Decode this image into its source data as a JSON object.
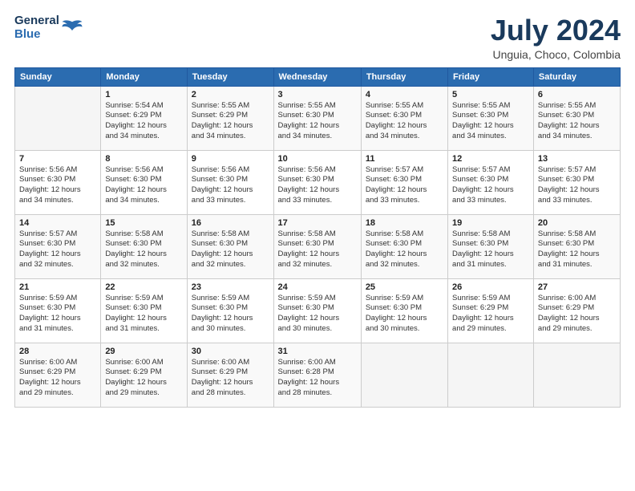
{
  "header": {
    "logo_line1": "General",
    "logo_line2": "Blue",
    "month": "July 2024",
    "location": "Unguia, Choco, Colombia"
  },
  "weekdays": [
    "Sunday",
    "Monday",
    "Tuesday",
    "Wednesday",
    "Thursday",
    "Friday",
    "Saturday"
  ],
  "weeks": [
    [
      {
        "day": "",
        "info": ""
      },
      {
        "day": "1",
        "info": "Sunrise: 5:54 AM\nSunset: 6:29 PM\nDaylight: 12 hours\nand 34 minutes."
      },
      {
        "day": "2",
        "info": "Sunrise: 5:55 AM\nSunset: 6:29 PM\nDaylight: 12 hours\nand 34 minutes."
      },
      {
        "day": "3",
        "info": "Sunrise: 5:55 AM\nSunset: 6:30 PM\nDaylight: 12 hours\nand 34 minutes."
      },
      {
        "day": "4",
        "info": "Sunrise: 5:55 AM\nSunset: 6:30 PM\nDaylight: 12 hours\nand 34 minutes."
      },
      {
        "day": "5",
        "info": "Sunrise: 5:55 AM\nSunset: 6:30 PM\nDaylight: 12 hours\nand 34 minutes."
      },
      {
        "day": "6",
        "info": "Sunrise: 5:55 AM\nSunset: 6:30 PM\nDaylight: 12 hours\nand 34 minutes."
      }
    ],
    [
      {
        "day": "7",
        "info": "Sunrise: 5:56 AM\nSunset: 6:30 PM\nDaylight: 12 hours\nand 34 minutes."
      },
      {
        "day": "8",
        "info": "Sunrise: 5:56 AM\nSunset: 6:30 PM\nDaylight: 12 hours\nand 34 minutes."
      },
      {
        "day": "9",
        "info": "Sunrise: 5:56 AM\nSunset: 6:30 PM\nDaylight: 12 hours\nand 33 minutes."
      },
      {
        "day": "10",
        "info": "Sunrise: 5:56 AM\nSunset: 6:30 PM\nDaylight: 12 hours\nand 33 minutes."
      },
      {
        "day": "11",
        "info": "Sunrise: 5:57 AM\nSunset: 6:30 PM\nDaylight: 12 hours\nand 33 minutes."
      },
      {
        "day": "12",
        "info": "Sunrise: 5:57 AM\nSunset: 6:30 PM\nDaylight: 12 hours\nand 33 minutes."
      },
      {
        "day": "13",
        "info": "Sunrise: 5:57 AM\nSunset: 6:30 PM\nDaylight: 12 hours\nand 33 minutes."
      }
    ],
    [
      {
        "day": "14",
        "info": "Sunrise: 5:57 AM\nSunset: 6:30 PM\nDaylight: 12 hours\nand 32 minutes."
      },
      {
        "day": "15",
        "info": "Sunrise: 5:58 AM\nSunset: 6:30 PM\nDaylight: 12 hours\nand 32 minutes."
      },
      {
        "day": "16",
        "info": "Sunrise: 5:58 AM\nSunset: 6:30 PM\nDaylight: 12 hours\nand 32 minutes."
      },
      {
        "day": "17",
        "info": "Sunrise: 5:58 AM\nSunset: 6:30 PM\nDaylight: 12 hours\nand 32 minutes."
      },
      {
        "day": "18",
        "info": "Sunrise: 5:58 AM\nSunset: 6:30 PM\nDaylight: 12 hours\nand 32 minutes."
      },
      {
        "day": "19",
        "info": "Sunrise: 5:58 AM\nSunset: 6:30 PM\nDaylight: 12 hours\nand 31 minutes."
      },
      {
        "day": "20",
        "info": "Sunrise: 5:58 AM\nSunset: 6:30 PM\nDaylight: 12 hours\nand 31 minutes."
      }
    ],
    [
      {
        "day": "21",
        "info": "Sunrise: 5:59 AM\nSunset: 6:30 PM\nDaylight: 12 hours\nand 31 minutes."
      },
      {
        "day": "22",
        "info": "Sunrise: 5:59 AM\nSunset: 6:30 PM\nDaylight: 12 hours\nand 31 minutes."
      },
      {
        "day": "23",
        "info": "Sunrise: 5:59 AM\nSunset: 6:30 PM\nDaylight: 12 hours\nand 30 minutes."
      },
      {
        "day": "24",
        "info": "Sunrise: 5:59 AM\nSunset: 6:30 PM\nDaylight: 12 hours\nand 30 minutes."
      },
      {
        "day": "25",
        "info": "Sunrise: 5:59 AM\nSunset: 6:30 PM\nDaylight: 12 hours\nand 30 minutes."
      },
      {
        "day": "26",
        "info": "Sunrise: 5:59 AM\nSunset: 6:29 PM\nDaylight: 12 hours\nand 29 minutes."
      },
      {
        "day": "27",
        "info": "Sunrise: 6:00 AM\nSunset: 6:29 PM\nDaylight: 12 hours\nand 29 minutes."
      }
    ],
    [
      {
        "day": "28",
        "info": "Sunrise: 6:00 AM\nSunset: 6:29 PM\nDaylight: 12 hours\nand 29 minutes."
      },
      {
        "day": "29",
        "info": "Sunrise: 6:00 AM\nSunset: 6:29 PM\nDaylight: 12 hours\nand 29 minutes."
      },
      {
        "day": "30",
        "info": "Sunrise: 6:00 AM\nSunset: 6:29 PM\nDaylight: 12 hours\nand 28 minutes."
      },
      {
        "day": "31",
        "info": "Sunrise: 6:00 AM\nSunset: 6:28 PM\nDaylight: 12 hours\nand 28 minutes."
      },
      {
        "day": "",
        "info": ""
      },
      {
        "day": "",
        "info": ""
      },
      {
        "day": "",
        "info": ""
      }
    ]
  ]
}
